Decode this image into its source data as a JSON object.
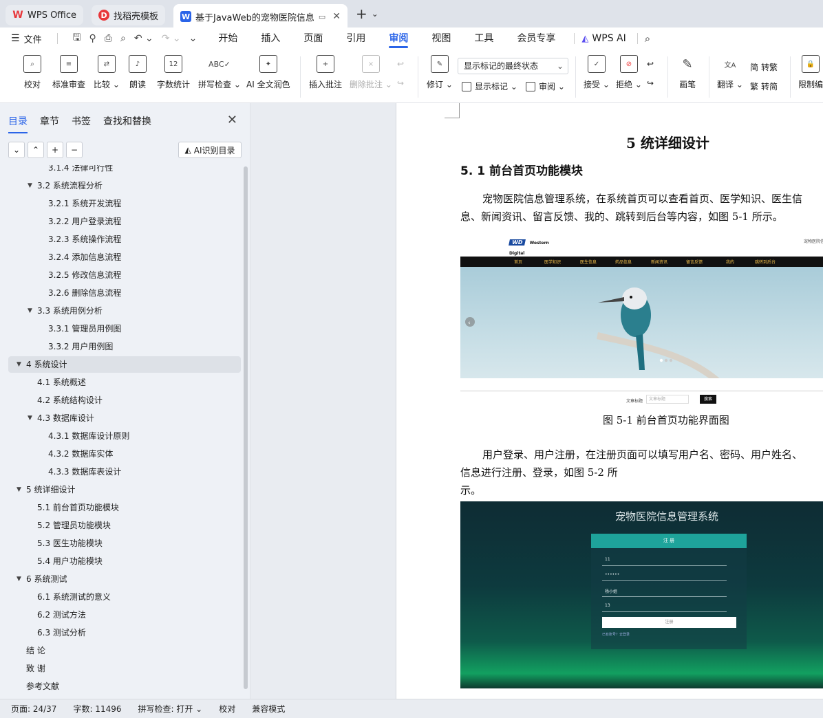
{
  "tabs": [
    {
      "label": "WPS Office",
      "icon": "wps-logo-icon",
      "color": "#e8363a"
    },
    {
      "label": "找稻壳模板",
      "icon": "docer-icon",
      "color": "#e8363a"
    },
    {
      "label": "基于JavaWeb的宠物医院信息",
      "icon": "word-doc-icon",
      "color": "#2a64e8"
    }
  ],
  "menubar": {
    "file_label": "文件",
    "tabs": [
      "开始",
      "插入",
      "页面",
      "引用",
      "审阅",
      "视图",
      "工具",
      "会员专享"
    ],
    "active_tab": "审阅",
    "ai_label": "WPS AI"
  },
  "ribbon": {
    "proofread": "校对",
    "standard_review": "标准审查",
    "compare": "比较",
    "read_aloud": "朗读",
    "word_count": "字数统计",
    "spell_check": "拼写检查",
    "ai_polish": "AI 全文润色",
    "insert_comment": "插入批注",
    "delete_comment": "删除批注",
    "revise": "修订",
    "markup_select": "显示标记的最终状态",
    "show_markup": "显示标记",
    "review": "审阅",
    "accept": "接受",
    "reject": "拒绝",
    "pen": "画笔",
    "translate": "翻译",
    "to_traditional": "转繁",
    "to_simplified": "转简",
    "restrict_edit": "限制编"
  },
  "sidebar": {
    "tabs": [
      "目录",
      "章节",
      "书签",
      "查找和替换"
    ],
    "active_tab": "目录",
    "ai_toc_button": "AI识别目录",
    "toc": [
      {
        "label": "3.1.4  法律可行性",
        "level": 3,
        "arrow": false,
        "partial": true
      },
      {
        "label": "3.2 系统流程分析",
        "level": 2,
        "arrow": true
      },
      {
        "label": "3.2.1 系统开发流程",
        "level": 3,
        "arrow": false
      },
      {
        "label": "3.2.2  用户登录流程",
        "level": 3,
        "arrow": false
      },
      {
        "label": "3.2.3  系统操作流程",
        "level": 3,
        "arrow": false
      },
      {
        "label": "3.2.4  添加信息流程",
        "level": 3,
        "arrow": false
      },
      {
        "label": "3.2.5  修改信息流程",
        "level": 3,
        "arrow": false
      },
      {
        "label": "3.2.6  删除信息流程",
        "level": 3,
        "arrow": false
      },
      {
        "label": "3.3 系统用例分析",
        "level": 2,
        "arrow": true
      },
      {
        "label": "3.3.1 管理员用例图",
        "level": 3,
        "arrow": false
      },
      {
        "label": "3.3.2 用户用例图",
        "level": 3,
        "arrow": false
      },
      {
        "label": "4  系统设计",
        "level": 1,
        "arrow": true,
        "selected": true
      },
      {
        "label": "4.1  系统概述",
        "level": 2,
        "arrow": false
      },
      {
        "label": "4.2  系统结构设计",
        "level": 2,
        "arrow": false
      },
      {
        "label": "4.3 数据库设计",
        "level": 2,
        "arrow": true
      },
      {
        "label": "4.3.1  数据库设计原则",
        "level": 3,
        "arrow": false
      },
      {
        "label": "4.3.2  数据库实体",
        "level": 3,
        "arrow": false
      },
      {
        "label": "4.3.3  数据库表设计",
        "level": 3,
        "arrow": false
      },
      {
        "label": "5 统详细设计",
        "level": 1,
        "arrow": true
      },
      {
        "label": "5.1 前台首页功能模块",
        "level": 2,
        "arrow": false
      },
      {
        "label": "5.2 管理员功能模块",
        "level": 2,
        "arrow": false
      },
      {
        "label": "5.3 医生功能模块",
        "level": 2,
        "arrow": false
      },
      {
        "label": "5.4 用户功能模块",
        "level": 2,
        "arrow": false
      },
      {
        "label": "6 系统测试",
        "level": 1,
        "arrow": true
      },
      {
        "label": "6.1 系统测试的意义",
        "level": 2,
        "arrow": false
      },
      {
        "label": "6.2  测试方法",
        "level": 2,
        "arrow": false
      },
      {
        "label": "6.3 测试分析",
        "level": 2,
        "arrow": false
      },
      {
        "label": "结      论",
        "level": 1,
        "arrow": false
      },
      {
        "label": "致      谢",
        "level": 1,
        "arrow": false
      },
      {
        "label": "参考文献",
        "level": 1,
        "arrow": false
      }
    ]
  },
  "document": {
    "heading1": "5 统详细设计",
    "heading2": "5. 1 前台首页功能模块",
    "para1_line1": "宠物医院信息管理系统，在系统首页可以查看首页、医学知识、医生信",
    "para1_line2": "息、新闻资讯、留言反馈、我的、跳转到后台等内容，如图 5-1 所示。",
    "figure1": {
      "logo_text": "Western Digital",
      "logo_mark": "WD",
      "top_right": "宠物医院信息管",
      "nav": [
        "首页",
        "医学知识",
        "医生信息",
        "药品信息",
        "新闻资讯",
        "留言反馈",
        "我的",
        "跳转到后台"
      ],
      "search_label": "文章标题",
      "search_placeholder": "文章标题",
      "search_button": "搜索"
    },
    "caption1": "图 5-1 前台首页功能界面图",
    "para2_line1": "用户登录、用户注册，在注册页面可以填写用户名、密码、用户姓名、",
    "para2_line2": "信息进行注册、登录，如图 5-2 所",
    "para2_line3": "示。",
    "figure2": {
      "title": "宠物医院信息管理系统",
      "panel_title": "注 册",
      "field1": "11",
      "field2": "••••••",
      "field3": "杨小姐",
      "field4": "13",
      "submit": "注册",
      "link": "已有账号？去登录"
    }
  },
  "statusbar": {
    "page": "页面: 24/37",
    "words": "字数: 11496",
    "spell": "拼写检查: 打开",
    "proof": "校对",
    "compat": "兼容模式"
  }
}
